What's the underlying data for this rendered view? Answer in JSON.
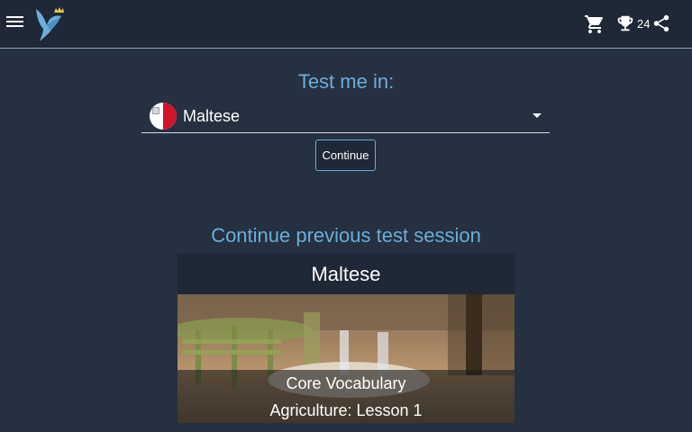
{
  "header": {
    "menu_icon": "hamburger-menu-icon",
    "logo_icon": "bird-logo-icon",
    "cart_icon": "shopping-cart-icon",
    "trophy_icon": "trophy-icon",
    "trophy_count": "24",
    "share_icon": "share-icon"
  },
  "test": {
    "title": "Test me in:",
    "language": "Maltese",
    "flag_icon": "malta-flag-icon",
    "continue_label": "Continue"
  },
  "previous_session": {
    "title": "Continue previous test session",
    "language": "Maltese",
    "category": "Core Vocabulary",
    "lesson": "Agriculture: Lesson 1"
  },
  "colors": {
    "background": "#253040",
    "topbar": "#1e2836",
    "accent": "#6aaedc"
  }
}
